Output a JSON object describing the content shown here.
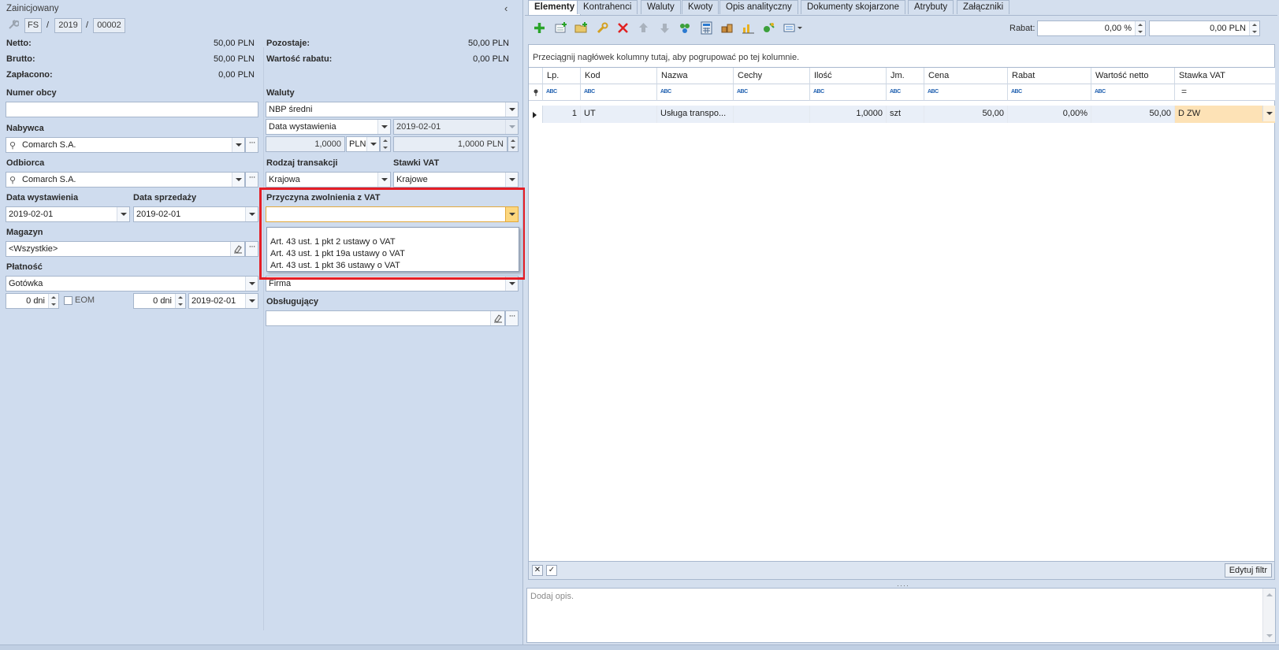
{
  "header": {
    "status": "Zainicjowany",
    "doc_type": "FS",
    "doc_year": "2019",
    "doc_number": "00002",
    "separator": "/"
  },
  "totals": {
    "netto_label": "Netto:",
    "netto_value": "50,00 PLN",
    "brutto_label": "Brutto:",
    "brutto_value": "50,00 PLN",
    "zaplacono_label": "Zapłacono:",
    "zaplacono_value": "0,00 PLN",
    "pozostaje_label": "Pozostaje:",
    "pozostaje_value": "50,00 PLN",
    "wartosc_rabatu_label": "Wartość rabatu:",
    "wartosc_rabatu_value": "0,00 PLN"
  },
  "left_form": {
    "numer_obcy_label": "Numer obcy",
    "numer_obcy_value": "",
    "nabywca_label": "Nabywca",
    "nabywca_value": "Comarch S.A.",
    "odbiorca_label": "Odbiorca",
    "odbiorca_value": "Comarch S.A.",
    "data_wystawienia_label": "Data wystawienia",
    "data_wystawienia_value": "2019-02-01",
    "data_sprzedazy_label": "Data sprzedaży",
    "data_sprzedazy_value": "2019-02-01",
    "magazyn_label": "Magazyn",
    "magazyn_value": "<Wszystkie>",
    "platnosc_label": "Płatność",
    "platnosc_value": "Gotówka",
    "termin_dni": "0 dni",
    "eom_label": "EOM",
    "termin2_dni": "0 dni",
    "termin_date": "2019-02-01"
  },
  "right_form": {
    "waluty_label": "Waluty",
    "waluty_value": "NBP średni",
    "kurs_typ_value": "Data wystawienia",
    "kurs_date_value": "2019-02-01",
    "kurs_ilosc": "1,0000",
    "kurs_waluta": "PLN",
    "kurs_wartosc": "1,0000 PLN",
    "rodzaj_transakcji_label": "Rodzaj transakcji",
    "rodzaj_transakcji_value": "Krajowa",
    "stawki_vat_label": "Stawki VAT",
    "stawki_vat_value": "Krajowe",
    "przyczyna_label": "Przyczyna zwolnienia z VAT",
    "przyczyna_value": "",
    "przyczyna_options": [
      "Art. 43 ust. 1 pkt 2 ustawy o VAT",
      "Art. 43 ust. 1 pkt 19a ustawy o VAT",
      "Art. 43 ust. 1 pkt 36 ustawy o VAT"
    ],
    "firma_value": "Firma",
    "obslugujacy_label": "Obsługujący",
    "obslugujacy_value": ""
  },
  "tabs": [
    "Elementy",
    "Kontrahenci",
    "Waluty",
    "Kwoty",
    "Opis analityczny",
    "Dokumenty skojarzone",
    "Atrybuty",
    "Załączniki"
  ],
  "toolbar": {
    "rabat_label": "Rabat:",
    "rabat_percent": "0,00 %",
    "rabat_amount": "0,00 PLN"
  },
  "grid": {
    "group_hint": "Przeciągnij nagłówek kolumny tutaj, aby pogrupować po tej kolumnie.",
    "columns": [
      "Lp.",
      "Kod",
      "Nazwa",
      "Cechy",
      "Ilość",
      "Jm.",
      "Cena",
      "Rabat",
      "Wartość netto",
      "Stawka VAT"
    ],
    "filter_abc": "ABC",
    "filter_eq": "=",
    "rows": [
      {
        "lp": "1",
        "kod": "UT",
        "nazwa": "Usługa transpo...",
        "cechy": "",
        "ilosc": "1,0000",
        "jm": "szt",
        "cena": "50,00",
        "rabat": "0,00%",
        "wartosc_netto": "50,00",
        "stawka_vat": "D ZW"
      }
    ],
    "edit_filter_label": "Edytuj filtr"
  },
  "description": {
    "placeholder": "Dodaj opis."
  },
  "colors": {
    "highlight_box": "#e51e26",
    "vat_cell": "#fde2b6",
    "panel_bg": "#cfdcee"
  }
}
